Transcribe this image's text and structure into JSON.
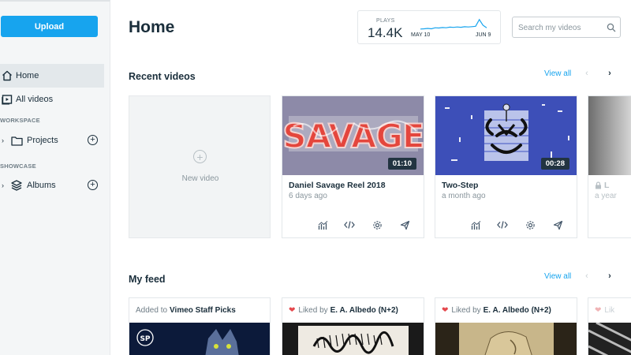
{
  "sidebar": {
    "upload_label": "Upload",
    "nav": [
      {
        "label": "Home",
        "icon": "home-icon",
        "active": true
      },
      {
        "label": "All videos",
        "icon": "play-box-icon",
        "active": false
      }
    ],
    "workspace_label": "WORKSPACE",
    "projects_label": "Projects",
    "showcase_label": "SHOWCASE",
    "albums_label": "Albums"
  },
  "header": {
    "title": "Home",
    "plays": {
      "label": "PLAYS",
      "value": "14.4K",
      "date_start": "MAY 10",
      "date_end": "JUN 9",
      "spark": [
        0.2,
        0.22,
        0.25,
        0.22,
        0.3,
        0.28,
        0.32,
        0.3,
        0.35,
        0.33,
        0.36,
        0.34,
        0.38,
        0.36,
        0.39,
        0.42,
        0.95,
        0.5,
        0.3
      ]
    },
    "search_placeholder": "Search my videos"
  },
  "recent": {
    "title": "Recent videos",
    "view_all": "View all",
    "new_video_label": "New video",
    "videos": [
      {
        "title": "Daniel Savage Reel 2018",
        "date": "6 days ago",
        "duration": "01:10",
        "thumb_text": "SAVAGE"
      },
      {
        "title": "Two-Step",
        "date": "a month ago",
        "duration": "00:28"
      },
      {
        "title": "L",
        "date": "a year"
      }
    ]
  },
  "feed": {
    "title": "My feed",
    "view_all": "View all",
    "items": [
      {
        "prefix": "Added to",
        "source": "Vimeo Staff Picks",
        "badge": "SP"
      },
      {
        "prefix": "Liked by",
        "source": "E. A. Albedo (N+2)"
      },
      {
        "prefix": "Liked by",
        "source": "E. A. Albedo (N+2)"
      },
      {
        "prefix": "Lik",
        "source": ""
      }
    ]
  },
  "colors": {
    "accent": "#17a4ee",
    "text": "#1a2e3b",
    "muted": "#8a969d",
    "heart": "#e5484d"
  }
}
